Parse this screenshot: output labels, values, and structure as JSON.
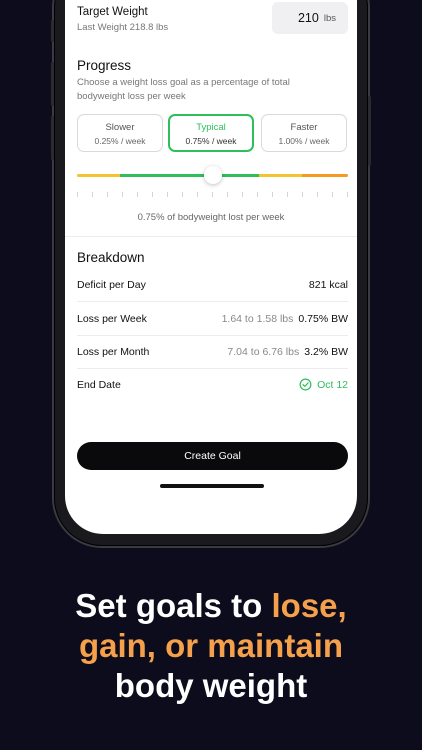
{
  "target": {
    "title": "Target Weight",
    "last_weight": "Last Weight 218.8 lbs",
    "value": "210",
    "unit": "lbs"
  },
  "progress": {
    "title": "Progress",
    "description": "Choose a weight loss goal as a percentage of total bodyweight loss per week",
    "options": [
      {
        "name": "Slower",
        "rate": "0.25% / week"
      },
      {
        "name": "Typical",
        "rate": "0.75% / week"
      },
      {
        "name": "Faster",
        "rate": "1.00% / week"
      }
    ],
    "selected_index": 1,
    "slider_fraction": 0.5,
    "slider_caption": "0.75% of bodyweight lost per week",
    "colors": {
      "yellow": "#f4c430",
      "green": "#2ebf5b",
      "orange": "#f59a23"
    }
  },
  "breakdown": {
    "title": "Breakdown",
    "rows": [
      {
        "label": "Deficit per Day",
        "range": "",
        "value": "821 kcal"
      },
      {
        "label": "Loss per Week",
        "range": "1.64 to 1.58 lbs",
        "value": "0.75% BW"
      },
      {
        "label": "Loss per Month",
        "range": "7.04 to 6.76 lbs",
        "value": "3.2% BW"
      }
    ],
    "end_date": {
      "label": "End Date",
      "value": "Oct 12",
      "icon": "check-circle-icon"
    }
  },
  "cta": {
    "label": "Create Goal"
  },
  "headline": {
    "line1_white": "Set goals to ",
    "line1_orange": "lose,",
    "line2_orange": "gain, or maintain",
    "line3_white": "body weight"
  },
  "accent_color": "#2ebf5b",
  "highlight_color": "#f5a04a"
}
